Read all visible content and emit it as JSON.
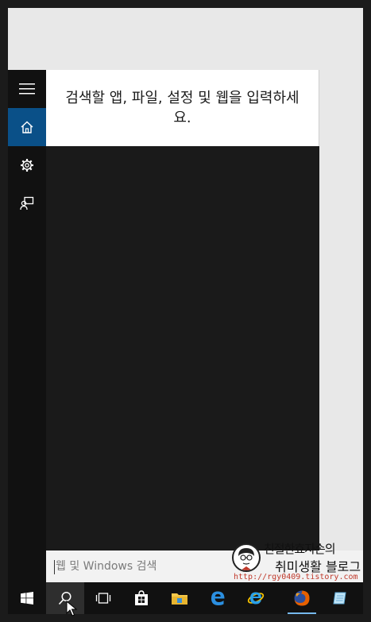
{
  "search_panel": {
    "prompt_text": "검색할 앱, 파일, 설정 및 웹을 입력하세요.",
    "rail": [
      {
        "icon": "hamburger-menu-icon",
        "active": false
      },
      {
        "icon": "home-icon",
        "active": true
      },
      {
        "icon": "gear-icon",
        "active": false
      },
      {
        "icon": "feedback-icon",
        "active": false
      }
    ]
  },
  "search_box": {
    "placeholder": "웹 및 Windows 검색"
  },
  "watermark": {
    "line1": "친절한효자손의",
    "line2": "취미생활 블로그",
    "url": "http://rgy0409.tistory.com"
  },
  "taskbar": {
    "items": [
      {
        "icon": "windows-start-icon"
      },
      {
        "icon": "search-icon",
        "active": true
      },
      {
        "icon": "task-view-icon"
      },
      {
        "icon": "store-icon"
      },
      {
        "icon": "file-explorer-icon"
      },
      {
        "icon": "edge-icon"
      },
      {
        "icon": "internet-explorer-icon"
      },
      {
        "icon": "firefox-icon",
        "running": true
      },
      {
        "icon": "notepad-icon"
      }
    ]
  },
  "colors": {
    "accent": "#0a5088",
    "panel": "#1a1a1a",
    "taskbar": "#111111"
  }
}
